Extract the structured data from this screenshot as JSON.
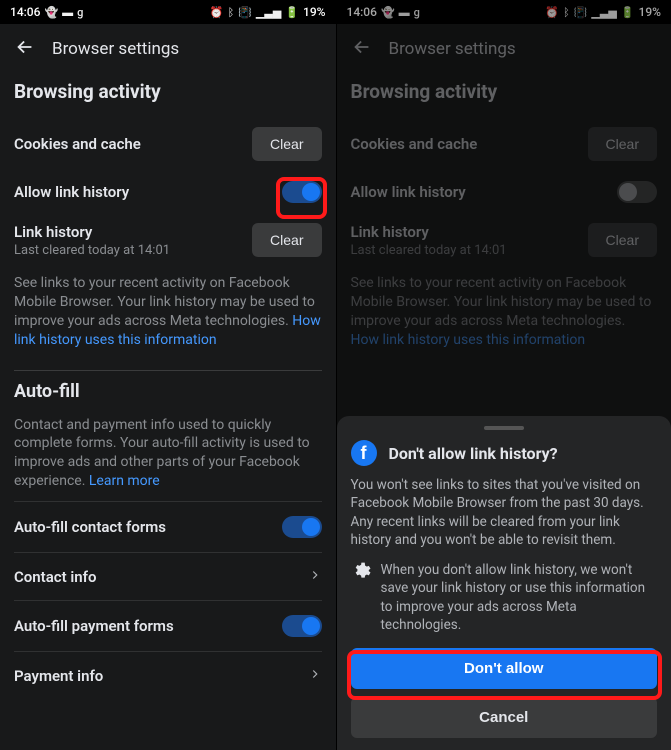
{
  "status": {
    "time": "14:06",
    "battery": "19%"
  },
  "header": {
    "title": "Browser settings"
  },
  "sections": {
    "browsing_title": "Browsing activity",
    "cookies_label": "Cookies and cache",
    "clear_btn": "Clear",
    "allow_link_history": "Allow link history",
    "link_history_label": "Link history",
    "link_history_sub": "Last cleared today at 14:01",
    "link_desc": "See links to your recent activity on Facebook Mobile Browser. Your link history may be used to improve your ads across Meta technologies. ",
    "link_desc_link": "How link history uses this information",
    "autofill_title": "Auto-fill",
    "autofill_desc": "Contact and payment info used to quickly complete forms. Your auto-fill activity is used to improve ads and other parts of your Facebook experience. ",
    "autofill_link": "Learn more",
    "af_contact_forms": "Auto-fill contact forms",
    "contact_info": "Contact info",
    "af_payment_forms": "Auto-fill payment forms",
    "payment_info": "Payment info"
  },
  "dialog": {
    "title": "Don't allow link history?",
    "body": "You won't see links to sites that you've visited on Facebook Mobile Browser from the past 30 days. Any recent links will be cleared from your link history and you won't be able to revisit them.",
    "info": "When you don't allow link history, we won't save your link history or use this information to improve your ads across Meta technologies.",
    "primary": "Don't allow",
    "secondary": "Cancel"
  }
}
